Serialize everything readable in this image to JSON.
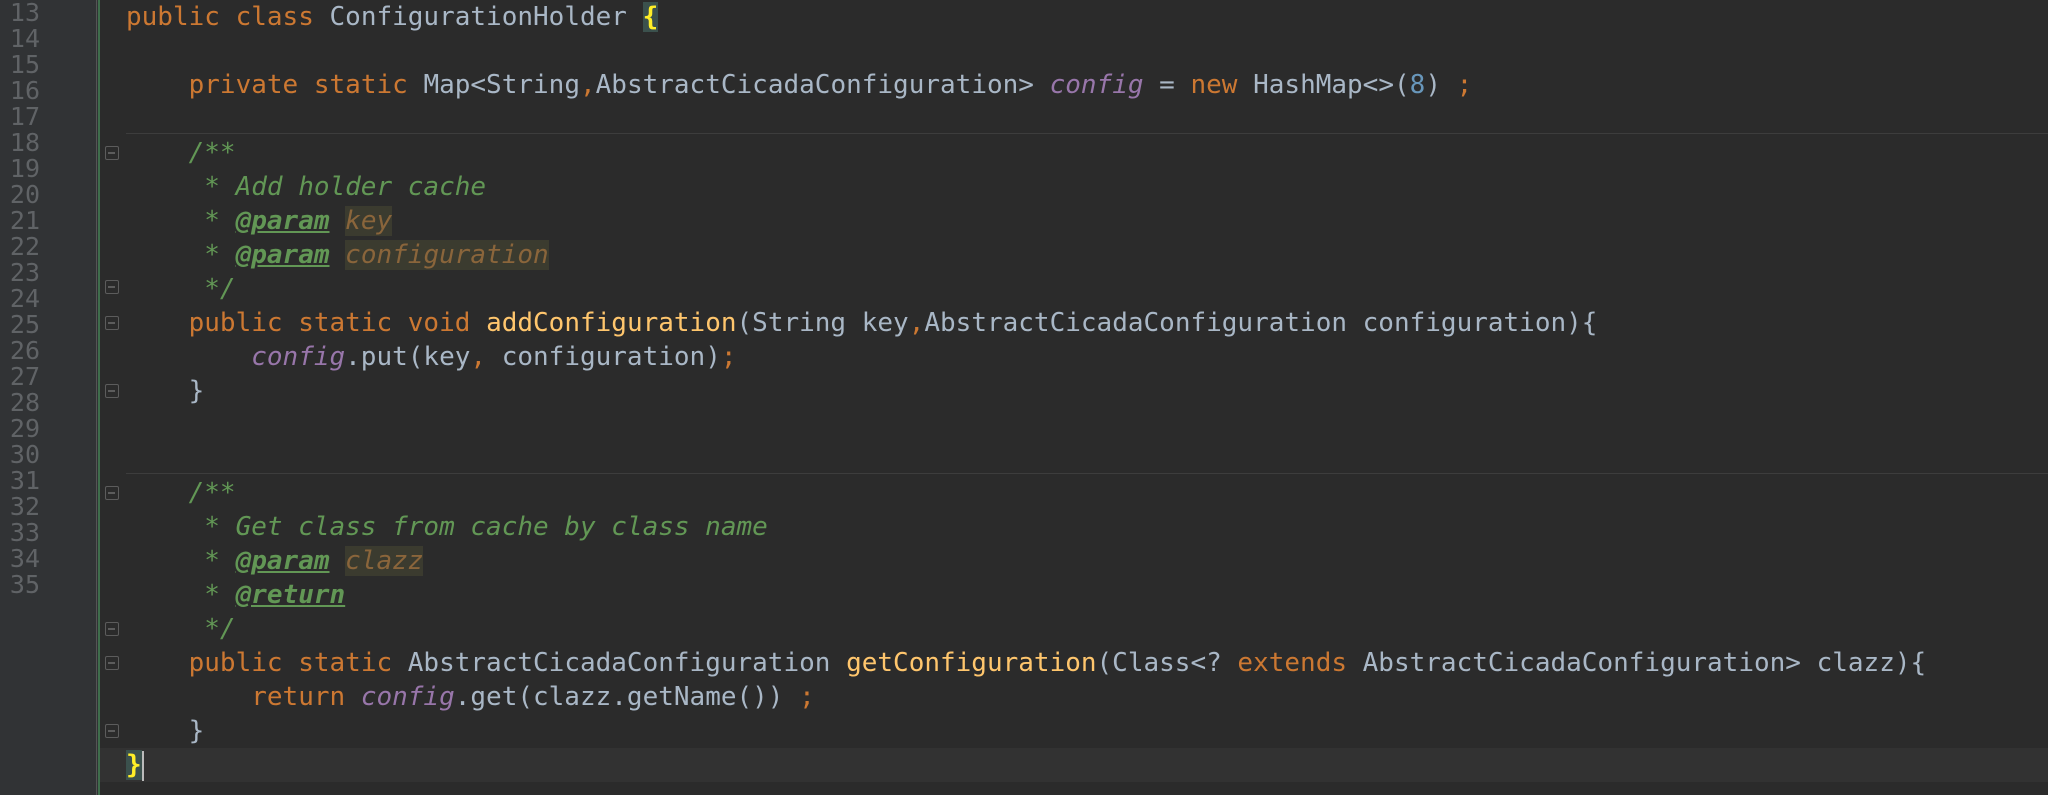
{
  "line_numbers": [
    "13",
    "14",
    "15",
    "16",
    "17",
    "18",
    "19",
    "20",
    "21",
    "22",
    "23",
    "24",
    "25",
    "26",
    "27",
    "28",
    "29",
    "30",
    "31",
    "32",
    "33",
    "34",
    "35"
  ],
  "code": {
    "l13": {
      "kw1": "public",
      "kw2": "class",
      "name": "ConfigurationHolder",
      "brace": "{"
    },
    "l15": {
      "kw1": "private",
      "kw2": "static",
      "type1": "Map<String",
      "comma": ",",
      "type2": "AbstractCicadaConfiguration>",
      "field": "config",
      "eq": " = ",
      "kw3": "new",
      "ctor": "HashMap<>(",
      "num": "8",
      "close": ") ",
      "semi": ";"
    },
    "l17": {
      "text": "/**"
    },
    "l18": {
      "text": " * Add holder cache"
    },
    "l19": {
      "star": " * ",
      "tag": "@param",
      "param": "key"
    },
    "l20": {
      "star": " * ",
      "tag": "@param",
      "param": "configuration"
    },
    "l21": {
      "text": " */"
    },
    "l22": {
      "kw1": "public",
      "kw2": "static",
      "kw3": "void",
      "fn": "addConfiguration",
      "p1": "(String key",
      "comma": ",",
      "p2": "AbstractCicadaConfiguration configuration){"
    },
    "l23": {
      "field": "config",
      "call": ".put(key",
      "comma": ",",
      "rest": " configuration)",
      "semi": ";"
    },
    "l24": {
      "text": "}"
    },
    "l27": {
      "text": "/**"
    },
    "l28": {
      "text": " * Get class from cache by class name"
    },
    "l29": {
      "star": " * ",
      "tag": "@param",
      "param": "clazz"
    },
    "l30": {
      "star": " * ",
      "tag": "@return"
    },
    "l31": {
      "text": " */"
    },
    "l32": {
      "kw1": "public",
      "kw2": "static",
      "type": "AbstractCicadaConfiguration",
      "fn": "getConfiguration",
      "p1": "(Class<? ",
      "kw3": "extends",
      "p2": " AbstractCicadaConfiguration> clazz){"
    },
    "l33": {
      "kw": "return",
      "field": "config",
      "call": ".get(clazz.getName()) ",
      "semi": ";"
    },
    "l34": {
      "text": "}"
    },
    "l35": {
      "brace": "}"
    }
  },
  "colors": {
    "background": "#2b2b2b",
    "keyword": "#cc7832",
    "function": "#ffc66d",
    "field": "#9876aa",
    "number": "#6897bb",
    "comment": "#629755",
    "default": "#a9b7c6",
    "gutter_text": "#606366"
  }
}
